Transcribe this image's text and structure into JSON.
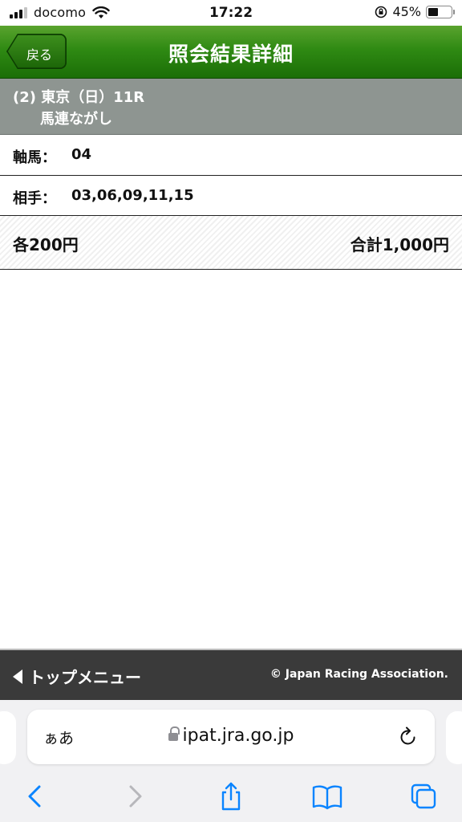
{
  "status_bar": {
    "carrier": "docomo",
    "time": "17:22",
    "battery_text": "45%",
    "battery_level": 0.45
  },
  "header": {
    "back_label": "戻る",
    "title": "照会結果詳細",
    "colors": {
      "green_top": "#5aa32e",
      "green_bottom": "#1b6e07"
    }
  },
  "race": {
    "line1": "(2) 東京（日）11R",
    "line2": "馬連ながし"
  },
  "details": {
    "axis_label": "軸馬：",
    "axis_value": "04",
    "partner_label": "相手：",
    "partner_value": "03,06,09,11,15"
  },
  "totals": {
    "each": "各200円",
    "sum": "合計1,000円"
  },
  "footer": {
    "top_menu_label": "トップメニュー",
    "copyright": "© Japan Racing Association."
  },
  "browser": {
    "aa_label": "ぁあ",
    "url": "ipat.jra.go.jp",
    "accent": "#0a84ff",
    "icons": [
      "back-arrow-icon",
      "forward-arrow-icon",
      "share-icon",
      "bookmarks-icon",
      "tabs-icon"
    ]
  }
}
